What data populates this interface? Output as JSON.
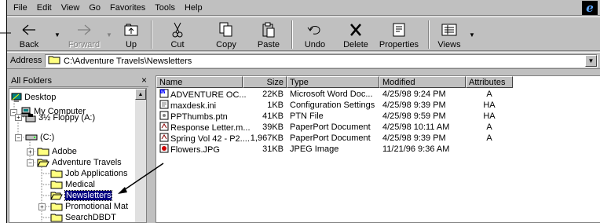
{
  "menu": [
    {
      "label": "File"
    },
    {
      "label": "Edit"
    },
    {
      "label": "View"
    },
    {
      "label": "Go"
    },
    {
      "label": "Favorites"
    },
    {
      "label": "Tools"
    },
    {
      "label": "Help"
    }
  ],
  "toolbar": {
    "back": "Back",
    "forward": "Forward",
    "up": "Up",
    "cut": "Cut",
    "copy": "Copy",
    "paste": "Paste",
    "undo": "Undo",
    "delete": "Delete",
    "properties": "Properties",
    "views": "Views"
  },
  "address": {
    "label": "Address",
    "value": "C:\\Adventure Travels\\Newsletters"
  },
  "folders": {
    "title": "All Folders",
    "close": "×",
    "tree": [
      {
        "label": "Desktop"
      },
      {
        "label": "My Computer"
      },
      {
        "label": "3½ Floppy (A:)"
      },
      {
        "label": "(C:)"
      },
      {
        "label": "Adobe"
      },
      {
        "label": "Adventure Travels"
      },
      {
        "label": "Job Applications"
      },
      {
        "label": "Medical"
      },
      {
        "label": "Newsletters"
      },
      {
        "label": "Promotional Mat"
      },
      {
        "label": "SearchDBDT"
      }
    ]
  },
  "list": {
    "columns": [
      "Name",
      "Size",
      "Type",
      "Modified",
      "Attributes"
    ],
    "rows": [
      {
        "name": "ADVENTURE OC...",
        "size": "22KB",
        "type": "Microsoft Word Doc...",
        "modified": "4/25/98 9:24 PM",
        "attr": "A",
        "icon": "word-doc-icon"
      },
      {
        "name": "maxdesk.ini",
        "size": "1KB",
        "type": "Configuration Settings",
        "modified": "4/25/98 9:39 PM",
        "attr": "HA",
        "icon": "ini-file-icon"
      },
      {
        "name": "PPThumbs.ptn",
        "size": "41KB",
        "type": "PTN File",
        "modified": "4/25/98 9:59 PM",
        "attr": "HA",
        "icon": "generic-file-icon"
      },
      {
        "name": "Response Letter.m...",
        "size": "39KB",
        "type": "PaperPort Document",
        "modified": "4/25/98 10:11 AM",
        "attr": "A",
        "icon": "paperport-doc-icon"
      },
      {
        "name": "Spring Vol 42 - P2....",
        "size": "1,967KB",
        "type": "PaperPort Document",
        "modified": "4/25/98 9:39 PM",
        "attr": "A",
        "icon": "paperport-doc-icon"
      },
      {
        "name": "Flowers.JPG",
        "size": "31KB",
        "type": "JPEG Image",
        "modified": "11/21/96 9:36 AM",
        "attr": "",
        "icon": "jpeg-image-icon"
      }
    ]
  },
  "colors": {
    "selection": "#000080",
    "face": "#c0c0c0",
    "folder": "#ffff80"
  }
}
